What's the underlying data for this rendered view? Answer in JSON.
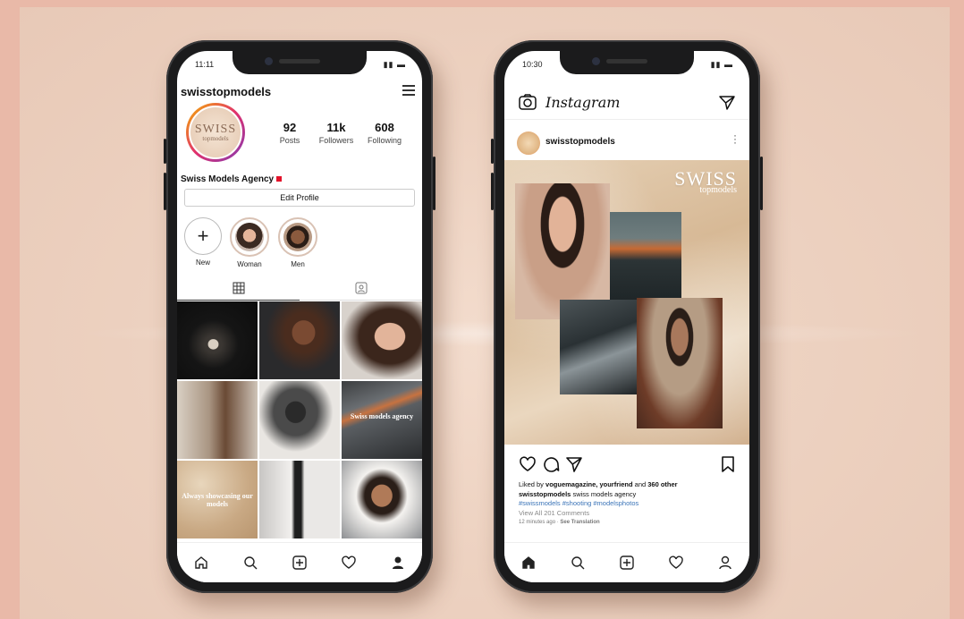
{
  "left_phone": {
    "status_time": "11:11",
    "status_icons": "▮▮ ▬",
    "username": "swisstopmodels",
    "avatar_logo": "SWISS",
    "avatar_logo_sub": "topmodels",
    "stats": [
      {
        "value": "92",
        "label": "Posts"
      },
      {
        "value": "11k",
        "label": "Followers"
      },
      {
        "value": "608",
        "label": "Following"
      }
    ],
    "bio_name": "Swiss Models Agency",
    "edit_profile": "Edit Profile",
    "highlights": [
      {
        "label": "New",
        "icon": "plus-icon"
      },
      {
        "label": "Woman",
        "icon": "woman-portrait"
      },
      {
        "label": "Men",
        "icon": "man-portrait"
      }
    ],
    "grid_texts": {
      "post6": "Swiss models agency",
      "post7": "Always showcasing our models"
    },
    "nav_icons": [
      "home-icon",
      "search-icon",
      "add-icon",
      "heart-icon",
      "profile-icon"
    ]
  },
  "right_phone": {
    "status_time": "10:30",
    "status_icons": "▮▮ ▬",
    "app_title": "Instagram",
    "post_user": "swisstopmodels",
    "watermark": "SWISS",
    "watermark_sub": "topmodels",
    "liked_prefix": "Liked by ",
    "liked_users": "voguemagazine, yourfriend",
    "liked_and": " and ",
    "liked_others": "360 other",
    "caption_user": "swisstopmodels",
    "caption_text": " swiss models agency",
    "hashtags": "#swissmodels #shooting #modelsphotos",
    "view_comments": "View All 201 Comments",
    "timestamp": "12 minutes ago",
    "see_translation": "See Translation",
    "nav_icons": [
      "home-icon",
      "search-icon",
      "add-icon",
      "heart-icon",
      "profile-icon"
    ]
  },
  "colors": {
    "background": "#e9b9a8",
    "phone_body": "#1b1b1c",
    "hashtag": "#3b74b8",
    "story_ring": "#e1306c"
  }
}
